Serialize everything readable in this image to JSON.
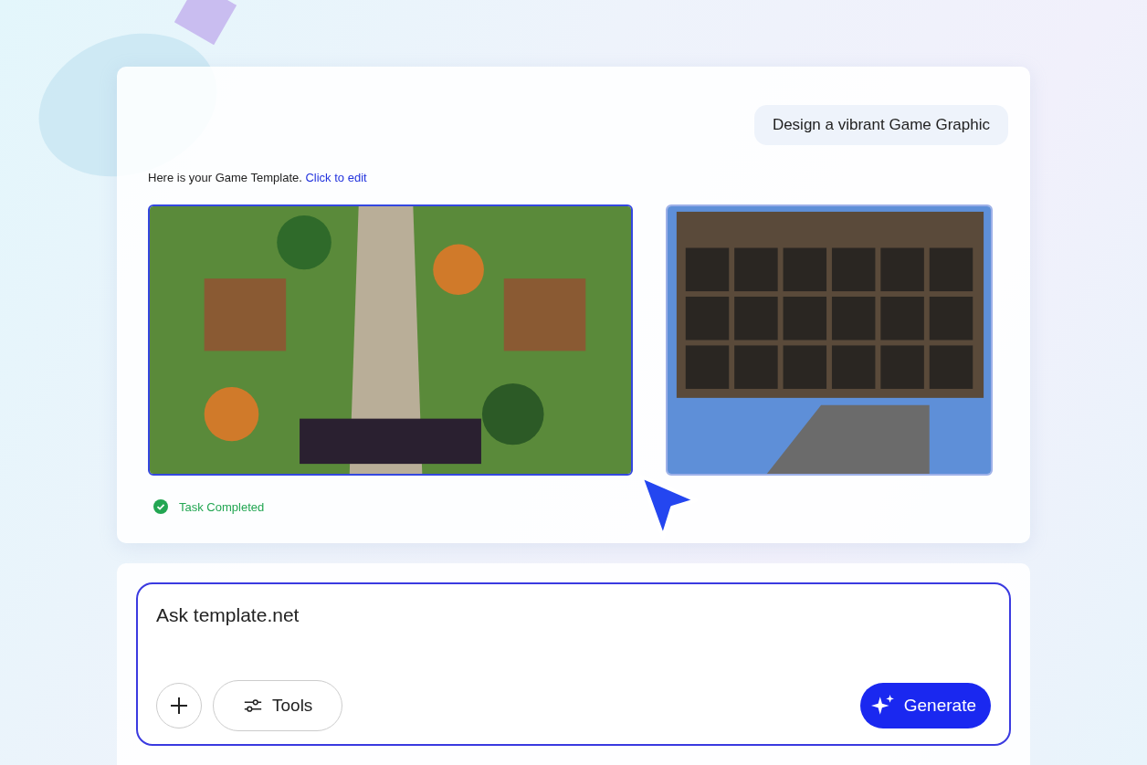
{
  "chat": {
    "user_message": "Design a vibrant Game Graphic",
    "reply": {
      "text": "Here is your Game Template.",
      "link": "Click to edit"
    },
    "images": [
      {
        "kind": "game-scene",
        "selected": true
      },
      {
        "kind": "tile-palette",
        "selected": false
      }
    ],
    "status": {
      "text": "Task Completed",
      "completed": true
    }
  },
  "composer": {
    "placeholder": "Ask template.net",
    "tools_label": "Tools",
    "generate_label": "Generate"
  }
}
